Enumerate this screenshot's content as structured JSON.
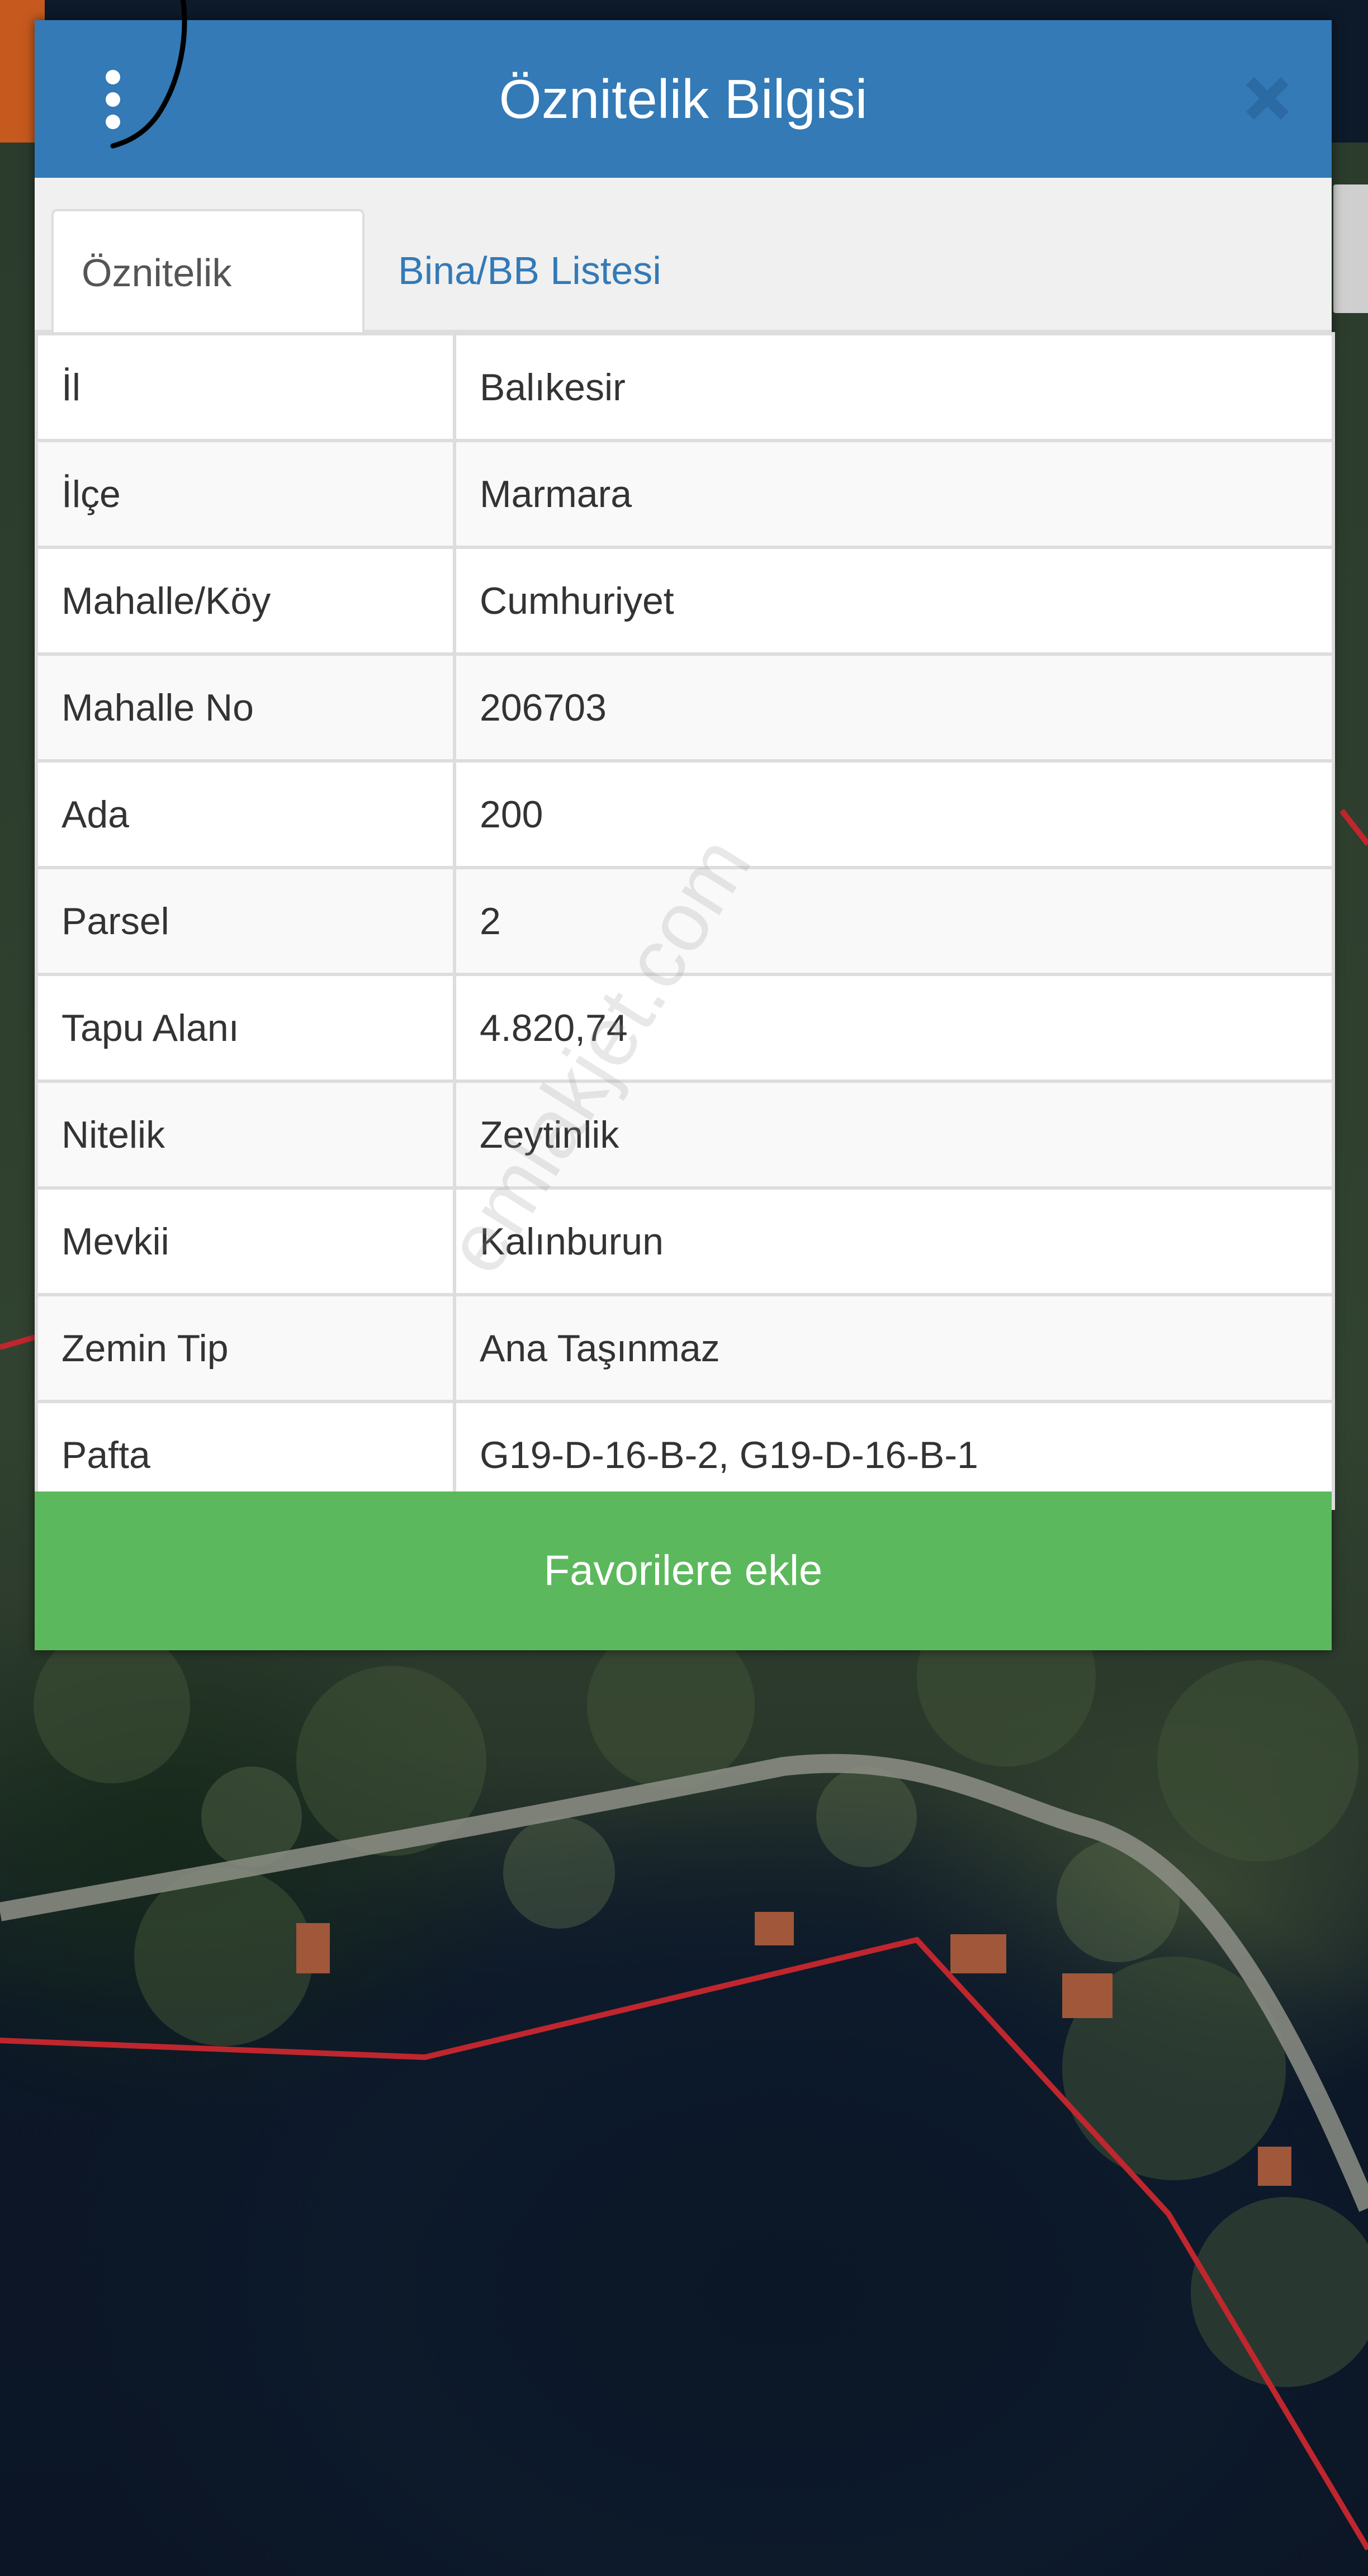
{
  "dialog": {
    "title": "Öznitelik Bilgisi"
  },
  "tabs": [
    {
      "label": "Öznitelik Bilgisi",
      "active": true
    },
    {
      "label": "Bina/BB Listesi",
      "active": false
    }
  ],
  "attributes": [
    {
      "key": "İl",
      "value": "Balıkesir"
    },
    {
      "key": "İlçe",
      "value": "Marmara"
    },
    {
      "key": "Mahalle/Köy",
      "value": "Cumhuriyet"
    },
    {
      "key": "Mahalle No",
      "value": "206703"
    },
    {
      "key": "Ada",
      "value": "200"
    },
    {
      "key": "Parsel",
      "value": "2"
    },
    {
      "key": "Tapu Alanı",
      "value": "4.820,74"
    },
    {
      "key": "Nitelik",
      "value": "Zeytinlik"
    },
    {
      "key": "Mevkii",
      "value": "Kalınburun"
    },
    {
      "key": "Zemin Tip",
      "value": "Ana Taşınmaz"
    },
    {
      "key": "Pafta",
      "value": "G19-D-16-B-2, G19-D-16-B-1"
    }
  ],
  "favorite_button": {
    "label": "Favorilere ekle"
  },
  "watermark": "emlakjet.com",
  "colors": {
    "header": "#337ab7",
    "button": "#5cb85c",
    "parcel_border": "#c0262d"
  },
  "icons": {
    "menu": "vertical-dots-icon",
    "close": "close-icon"
  }
}
